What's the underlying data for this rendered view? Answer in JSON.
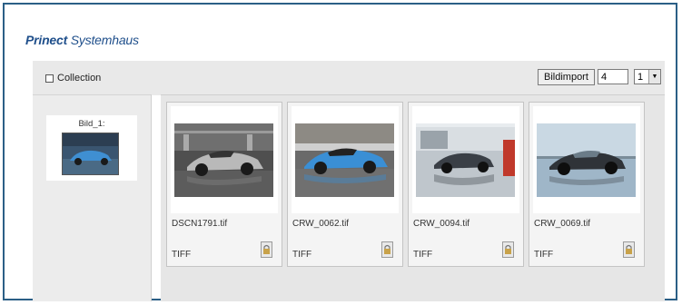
{
  "header": {
    "brand_bold": "Prinect",
    "brand_rest": " Systemhaus"
  },
  "toolbar": {
    "collection_label": "Collection",
    "collection_checked": false,
    "import_button": "Bildimport",
    "count_value": "4",
    "page_select_value": "1"
  },
  "collection": {
    "item_label": "Bild_1:",
    "thumb_icon": "car-photo"
  },
  "gallery": {
    "items": [
      {
        "filename": "DSCN1791.tif",
        "filetype": "TIFF",
        "lock_icon": "lock-icon",
        "photo": "silver-convertible-showroom"
      },
      {
        "filename": "CRW_0062.tif",
        "filetype": "TIFF",
        "lock_icon": "lock-icon",
        "photo": "blue-convertible-showroom"
      },
      {
        "filename": "CRW_0094.tif",
        "filetype": "TIFF",
        "lock_icon": "lock-icon",
        "photo": "dark-coupe-reflective-hall"
      },
      {
        "filename": "CRW_0069.tif",
        "filetype": "TIFF",
        "lock_icon": "lock-icon",
        "photo": "dark-coupe-glass-hall"
      }
    ]
  },
  "colors": {
    "brand": "#1f4f8b",
    "frame": "#2b5f86",
    "panel": "#e6e6e6"
  }
}
